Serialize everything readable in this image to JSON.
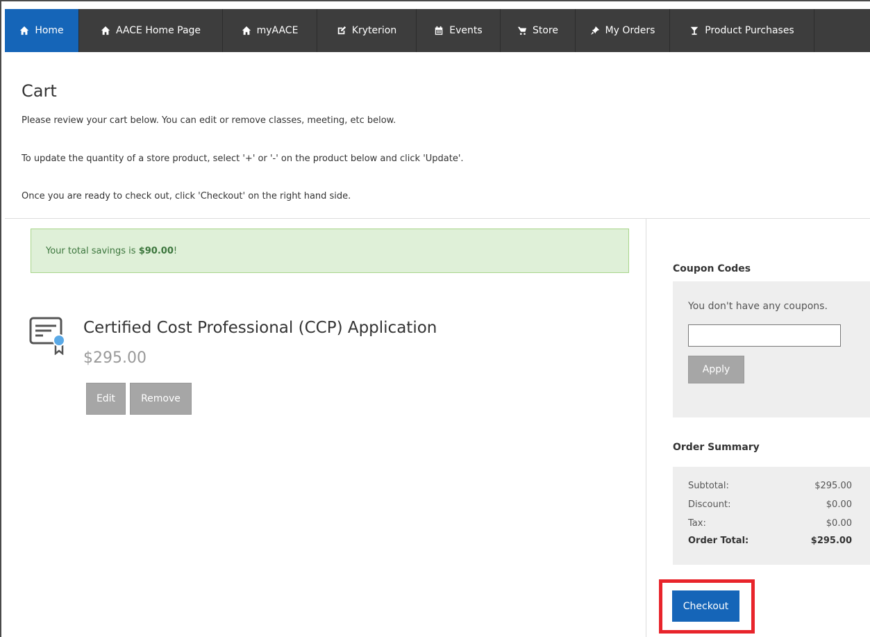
{
  "nav": {
    "items": [
      {
        "label": "Home",
        "icon": "home-icon",
        "active": true
      },
      {
        "label": "AACE Home Page",
        "icon": "home-icon"
      },
      {
        "label": "myAACE",
        "icon": "home-icon"
      },
      {
        "label": "Kryterion",
        "icon": "edit-icon"
      },
      {
        "label": "Events",
        "icon": "calendar-icon"
      },
      {
        "label": "Store",
        "icon": "cart-icon"
      },
      {
        "label": "My Orders",
        "icon": "pin-icon"
      },
      {
        "label": "Product Purchases",
        "icon": "glass-icon"
      }
    ],
    "active_color": "#1565b8",
    "bg_color": "#3d3d3d"
  },
  "page": {
    "title": "Cart",
    "intro": [
      "Please review your cart below. You can edit or remove classes, meeting, etc below.",
      "To update the quantity of a store product, select '+' or '-' on the product below and click 'Update'.",
      "Once you are ready to check out, click 'Checkout' on the right hand side."
    ]
  },
  "savings": {
    "prefix": "Your total savings is ",
    "amount": "$90.00",
    "suffix": "!"
  },
  "cart_item": {
    "icon": "certificate-icon",
    "title": "Certified Cost Professional (CCP) Application",
    "price": "$295.00",
    "edit_label": "Edit",
    "remove_label": "Remove"
  },
  "coupons": {
    "heading": "Coupon Codes",
    "message": "You don't have any coupons.",
    "input_value": "",
    "apply_label": "Apply"
  },
  "summary": {
    "heading": "Order Summary",
    "rows": [
      {
        "label": "Subtotal:",
        "value": "$295.00"
      },
      {
        "label": "Discount:",
        "value": "$0.00"
      },
      {
        "label": "Tax:",
        "value": "$0.00"
      },
      {
        "label": "Order Total:",
        "value": "$295.00"
      }
    ]
  },
  "checkout": {
    "label": "Checkout",
    "highlight_color": "#e8242b"
  }
}
